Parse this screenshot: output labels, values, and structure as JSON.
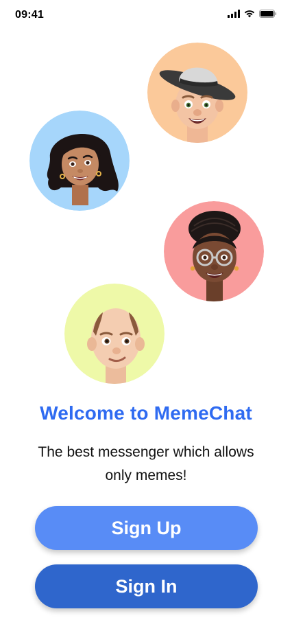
{
  "status_bar": {
    "time": "09:41",
    "icons": [
      "cellular-signal-icon",
      "wifi-icon",
      "battery-icon"
    ]
  },
  "avatars": [
    {
      "name": "avatar-man-hat",
      "bg": "#fbc99a"
    },
    {
      "name": "avatar-woman-dark-hair",
      "bg": "#a6d6fb"
    },
    {
      "name": "avatar-woman-glasses",
      "bg": "#f99c9c"
    },
    {
      "name": "avatar-man-bald",
      "bg": "#eef9a8"
    }
  ],
  "welcome": {
    "title": "Welcome to MemeChat",
    "subtitle": "The best messenger which allows only memes!"
  },
  "buttons": {
    "sign_up": "Sign Up",
    "sign_in": "Sign In"
  },
  "colors": {
    "title": "#2f6bf1",
    "sign_up_bg": "#588cf6",
    "sign_in_bg": "#2f66cc"
  }
}
